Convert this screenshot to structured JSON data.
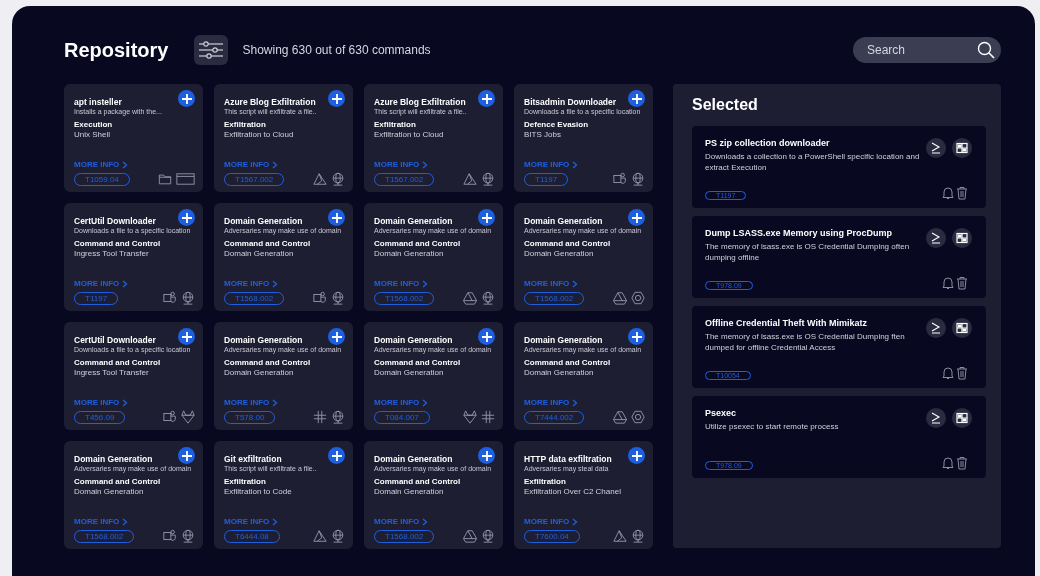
{
  "header": {
    "title": "Repository",
    "count_text": "Showing 630 out of 630 commands",
    "search": {
      "placeholder": "Search"
    }
  },
  "cards": [
    {
      "title": "apt insteller",
      "desc": "Installs a package with the...",
      "category": "Execution",
      "technique": "Unix Shell",
      "more": "MORE INFO",
      "id": "T1059.04",
      "platforms": [
        {
          "kind": "folder"
        },
        {
          "kind": "terminal-window"
        }
      ]
    },
    {
      "title": "Azure Blog Exfiltration",
      "desc": "This script will exfiltrate a file..",
      "category": "Exfiltration",
      "technique": "Exfiltration to Cloud",
      "more": "MORE INFO",
      "id": "T1567.002",
      "platforms": [
        {
          "kind": "azure"
        },
        {
          "kind": "globe"
        }
      ]
    },
    {
      "title": "Azure Blog Exfiltration",
      "desc": "This script will exfiltrate a file..",
      "category": "Exfiltration",
      "technique": "Exfiltration to Cloud",
      "more": "MORE INFO",
      "id": "T1567.002",
      "platforms": [
        {
          "kind": "azure"
        },
        {
          "kind": "globe"
        }
      ]
    },
    {
      "title": "Bitsadmin Downloader",
      "desc": "Downloads a file to a specific location",
      "category": "Defence Evasion",
      "technique": "BITS Jobs",
      "more": "MORE INFO",
      "id": "T1197",
      "platforms": [
        {
          "kind": "teams"
        },
        {
          "kind": "globe"
        }
      ]
    },
    {
      "title": "CertUtil Downloader",
      "desc": "Downloads a file to a specific location",
      "category": "Command and Control",
      "technique": "Ingress Tool Transfer",
      "more": "MORE INFO",
      "id": "T1197",
      "platforms": [
        {
          "kind": "teams"
        },
        {
          "kind": "globe"
        }
      ]
    },
    {
      "title": "Domain Generation",
      "desc": "Adversaries may make use of domain",
      "category": "Command and Control",
      "technique": "Domain Generation",
      "more": "MORE INFO",
      "id": "T1568.002",
      "platforms": [
        {
          "kind": "teams"
        },
        {
          "kind": "globe"
        }
      ]
    },
    {
      "title": "Domain Generation",
      "desc": "Adversaries may make use of domain",
      "category": "Command and Control",
      "technique": "Domain Generation",
      "more": "MORE INFO",
      "id": "T1568.002",
      "platforms": [
        {
          "kind": "drive"
        },
        {
          "kind": "globe"
        }
      ]
    },
    {
      "title": "Domain Generation",
      "desc": "Adversaries may make use of domain",
      "category": "Command and Control",
      "technique": "Domain Generation",
      "more": "MORE INFO",
      "id": "T1568.002",
      "platforms": [
        {
          "kind": "drive"
        },
        {
          "kind": "hexagon"
        }
      ]
    },
    {
      "title": "CertUtil Downloader",
      "desc": "Downloads a file to a specific location",
      "category": "Command and Control",
      "technique": "Ingress Tool Transfer",
      "more": "MORE INFO",
      "id": "T456.09",
      "platforms": [
        {
          "kind": "teams"
        },
        {
          "kind": "fox"
        }
      ]
    },
    {
      "title": "Domain Generation",
      "desc": "Adversaries may make use of domain",
      "category": "Command and Control",
      "technique": "Domain Generation",
      "more": "MORE INFO",
      "id": "T578.00",
      "platforms": [
        {
          "kind": "slack"
        },
        {
          "kind": "globe"
        }
      ]
    },
    {
      "title": "Domain Generation",
      "desc": "Adversaries may make use of domain",
      "category": "Command and Control",
      "technique": "Domain Generation",
      "more": "MORE INFO",
      "id": "T084.007",
      "platforms": [
        {
          "kind": "fox"
        },
        {
          "kind": "slack"
        }
      ]
    },
    {
      "title": "Domain Generation",
      "desc": "Adversaries may make use of domain",
      "category": "Command and Control",
      "technique": "Domain Generation",
      "more": "MORE INFO",
      "id": "T7444.002",
      "platforms": [
        {
          "kind": "drive"
        },
        {
          "kind": "hexagon"
        }
      ]
    },
    {
      "title": "Domain Generation",
      "desc": "Adversaries may make use of domain",
      "category": "Command and Control",
      "technique": "Domain Generation",
      "more": "MORE INFO",
      "id": "T1568.002",
      "platforms": [
        {
          "kind": "teams"
        },
        {
          "kind": "globe"
        }
      ]
    },
    {
      "title": "Git exfiltration",
      "desc": "This script will exfiltrate a file..",
      "category": "Exfiltration",
      "technique": "Exfiltration to Code",
      "more": "MORE INFO",
      "id": "T6444.08",
      "platforms": [
        {
          "kind": "azure"
        },
        {
          "kind": "globe"
        }
      ]
    },
    {
      "title": "Domain Generation",
      "desc": "Adversaries may make use of domain",
      "category": "Command and Control",
      "technique": "Domain Generation",
      "more": "MORE INFO",
      "id": "T1568.002",
      "platforms": [
        {
          "kind": "drive"
        },
        {
          "kind": "globe"
        }
      ]
    },
    {
      "title": "HTTP data exfiltration",
      "desc": "Adversaries may steal data",
      "category": "Exfiltration",
      "technique": "Exfiltration Over C2 Chanel",
      "more": "MORE INFO",
      "id": "T7600.04",
      "platforms": [
        {
          "kind": "azure"
        },
        {
          "kind": "globe"
        }
      ]
    }
  ],
  "selected": {
    "title": "Selected",
    "items": [
      {
        "title": "PS zip collection downloader",
        "desc": "Downloads a collection to a PowerShell specific location and extract Execution",
        "id": "T1197"
      },
      {
        "title": "Dump LSASS.exe Memory using ProcDump",
        "desc": "The memory of lsass.exe is OS Credential Dumping often dumping offline",
        "id": "T978.09"
      },
      {
        "title": "Offline Credential Theft With Mimikatz",
        "desc": "The memory of lsass.exe is OS Credential Dumping ften dumped for offline Credential Access",
        "id": "T10054"
      },
      {
        "title": "Psexec",
        "desc": "Utilize psexec to start remote process",
        "id": "T978.09"
      }
    ]
  }
}
